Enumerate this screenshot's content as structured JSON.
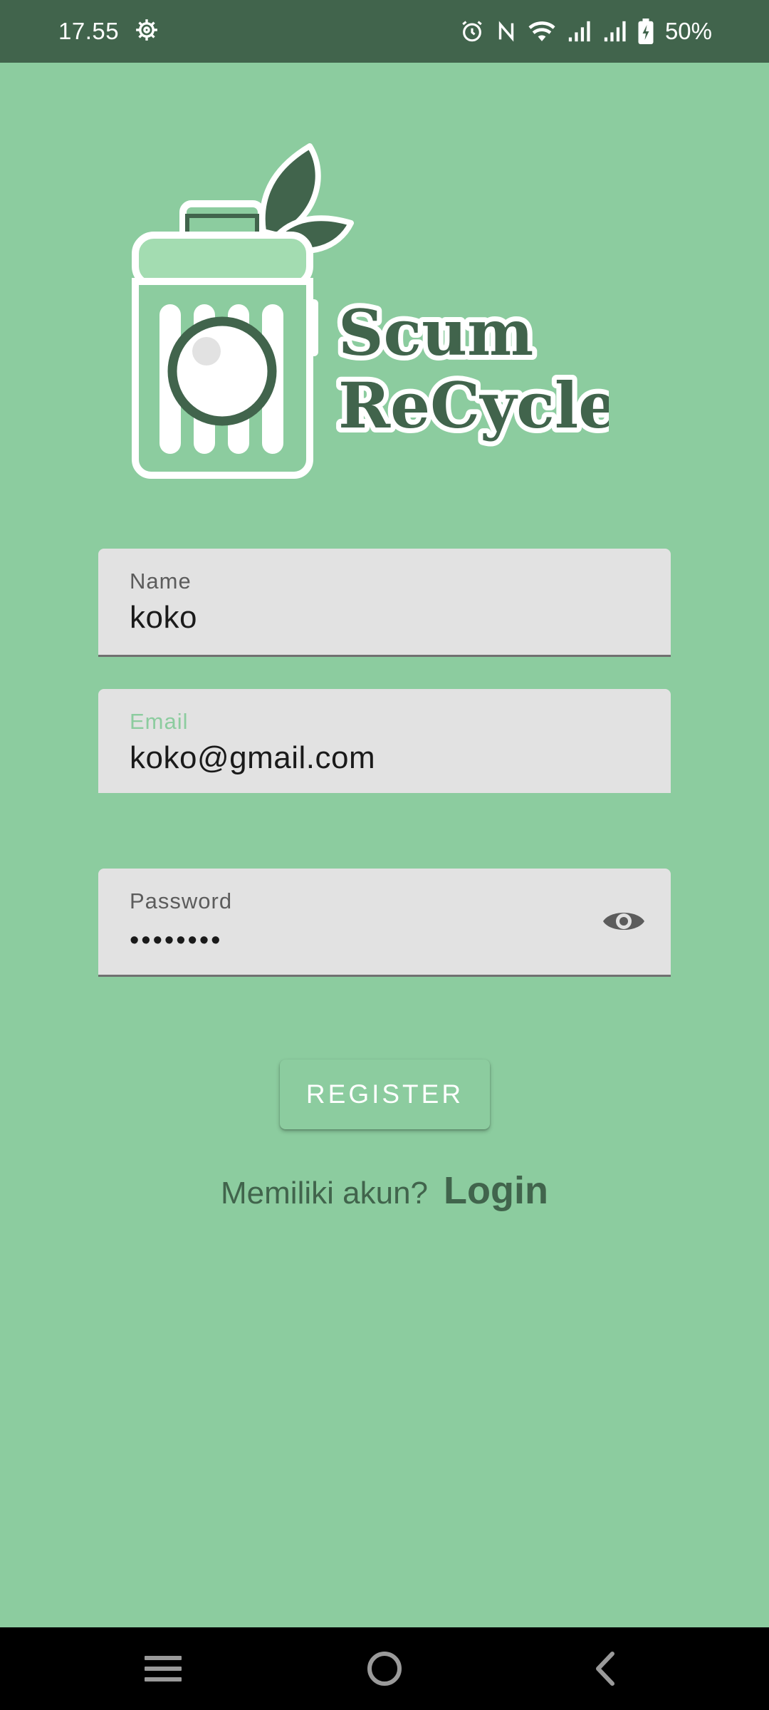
{
  "status_bar": {
    "time": "17.55",
    "battery_percent": "50%",
    "icons": [
      "settings-icon",
      "alarm-icon",
      "nfc-icon",
      "wifi-icon",
      "signal-icon",
      "signal-icon",
      "battery-charging-icon"
    ]
  },
  "logo": {
    "line1": "Scum",
    "line2": "ReCycle"
  },
  "form": {
    "name": {
      "label": "Name",
      "value": "koko"
    },
    "email": {
      "label": "Email",
      "value": "koko@gmail.com"
    },
    "password": {
      "label": "Password",
      "value": "••••••••"
    },
    "register_label": "REGISTER",
    "have_account_text": "Memiliki akun?",
    "login_label": "Login"
  },
  "nav_bar": {
    "icons": [
      "menu-icon",
      "home-icon",
      "back-icon"
    ]
  },
  "colors": {
    "background": "#8ccc9f",
    "dark_green": "#41644c",
    "field_bg": "#e2e2e2"
  }
}
